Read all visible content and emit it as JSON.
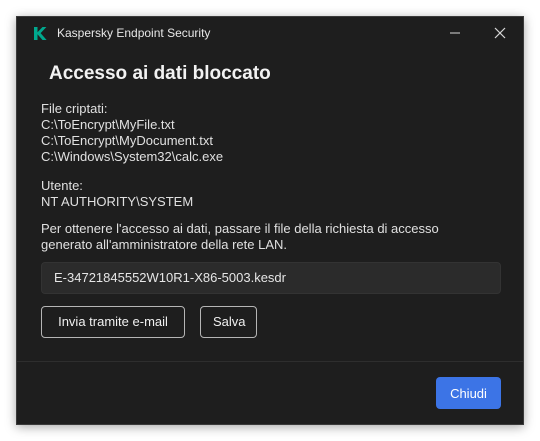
{
  "window": {
    "app_title": "Kaspersky Endpoint Security",
    "logo_icon": "kaspersky-k-icon",
    "minimize_icon": "minimize-icon",
    "close_icon": "close-icon"
  },
  "dialog": {
    "title": "Accesso ai dati bloccato",
    "files_label": "File criptati:",
    "files": [
      "C:\\ToEncrypt\\MyFile.txt",
      "C:\\ToEncrypt\\MyDocument.txt",
      "C:\\Windows\\System32\\calc.exe"
    ],
    "user_label": "Utente:",
    "user_value": "NT AUTHORITY\\SYSTEM",
    "instruction": "Per ottenere l'accesso ai dati, passare il file della richiesta di accesso generato all'amministratore della rete LAN.",
    "request_file": "E-34721845552W10R1-X86-5003.kesdr",
    "email_button": "Invia tramite e-mail",
    "save_button": "Salva",
    "close_button": "Chiudi"
  },
  "colors": {
    "window_bg": "#1e1e1e",
    "brand_green": "#00a88e",
    "primary_button": "#3c74e6",
    "field_bg": "#2b2b2b"
  }
}
